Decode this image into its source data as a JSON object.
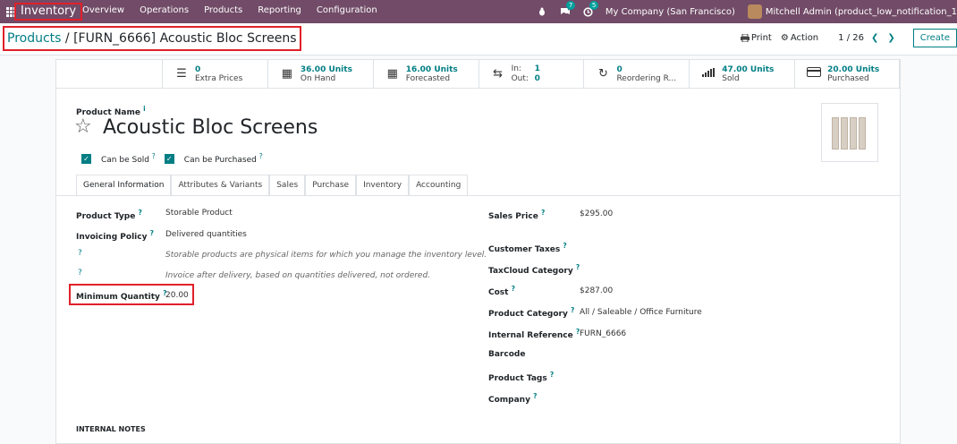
{
  "topbar": {
    "app_name": "Inventory",
    "menu": [
      "Overview",
      "Operations",
      "Products",
      "Reporting",
      "Configuration"
    ],
    "messages_badge": "7",
    "activities_badge": "5",
    "company": "My Company (San Francisco)",
    "user": "Mitchell Admin (product_low_notification_1"
  },
  "control": {
    "breadcrumb_parent": "Products",
    "breadcrumb_sep": "/",
    "breadcrumb_current": "[FURN_6666] Acoustic Bloc Screens",
    "print": "Print",
    "action": "Action",
    "pager": "1 / 26",
    "create": "Create"
  },
  "stats": [
    {
      "value": "0",
      "label": "Extra Prices",
      "icon": "list-icon"
    },
    {
      "value": "36.00 Units",
      "label": "On Hand",
      "icon": "cubes-icon"
    },
    {
      "value": "16.00 Units",
      "label": "Forecasted",
      "icon": "cubes-icon"
    },
    {
      "in_label": "In:",
      "in_value": "1",
      "out_label": "Out:",
      "out_value": "0",
      "icon": "exchange-icon"
    },
    {
      "value": "0",
      "label": "Reordering R...",
      "icon": "refresh-icon"
    },
    {
      "value": "47.00 Units",
      "label": "Sold",
      "icon": "signal-icon"
    },
    {
      "value": "20.00 Units",
      "label": "Purchased",
      "icon": "credit-card-icon"
    }
  ],
  "form": {
    "name_label": "Product Name",
    "name_info": "i",
    "name": "Acoustic Bloc Screens",
    "can_be_sold": "Can be Sold",
    "can_be_purchased": "Can be Purchased",
    "q": "?"
  },
  "tabs": [
    "General Information",
    "Attributes & Variants",
    "Sales",
    "Purchase",
    "Inventory",
    "Accounting"
  ],
  "left_fields": {
    "product_type_label": "Product Type",
    "product_type": "Storable Product",
    "invoicing_label": "Invoicing Policy",
    "invoicing": "Delivered quantities",
    "help1": "Storable products are physical items for which you manage the inventory level.",
    "help2": "Invoice after delivery, based on quantities delivered, not ordered.",
    "min_qty_label": "Minimum Quantity",
    "min_qty": "20.00"
  },
  "right_fields": {
    "sales_price_label": "Sales Price",
    "sales_price": "$295.00",
    "customer_taxes_label": "Customer Taxes",
    "taxcloud_label": "TaxCloud Category",
    "cost_label": "Cost",
    "cost": "$287.00",
    "category_label": "Product Category",
    "category": "All / Saleable / Office Furniture",
    "internal_ref_label": "Internal Reference",
    "internal_ref": "FURN_6666",
    "barcode_label": "Barcode",
    "tags_label": "Product Tags",
    "company_label": "Company"
  },
  "notes_label": "INTERNAL NOTES",
  "colors": {
    "brand": "#714b67",
    "accent": "#017e84",
    "highlight": "#e0202a"
  }
}
